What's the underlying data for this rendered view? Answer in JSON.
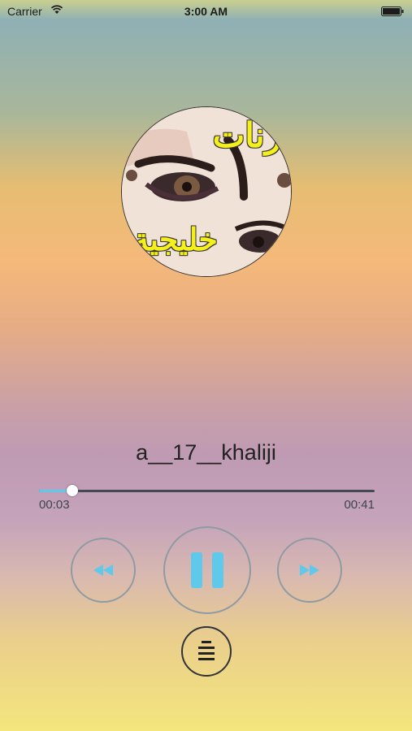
{
  "status_bar": {
    "carrier": "Carrier",
    "time": "3:00 AM"
  },
  "artwork": {
    "text_top": "رنات",
    "text_bottom": "خليجية"
  },
  "track": {
    "title": "a__17__khaliji"
  },
  "progress": {
    "elapsed": "00:03",
    "total": "00:41",
    "fraction": 0.1
  },
  "controls": {
    "rewind_icon": "rewind-icon",
    "pause_icon": "pause-icon",
    "forward_icon": "fast-forward-icon",
    "playlist_icon": "playlist-icon"
  },
  "colors": {
    "accent": "#5ec9ea",
    "title": "#222222"
  }
}
